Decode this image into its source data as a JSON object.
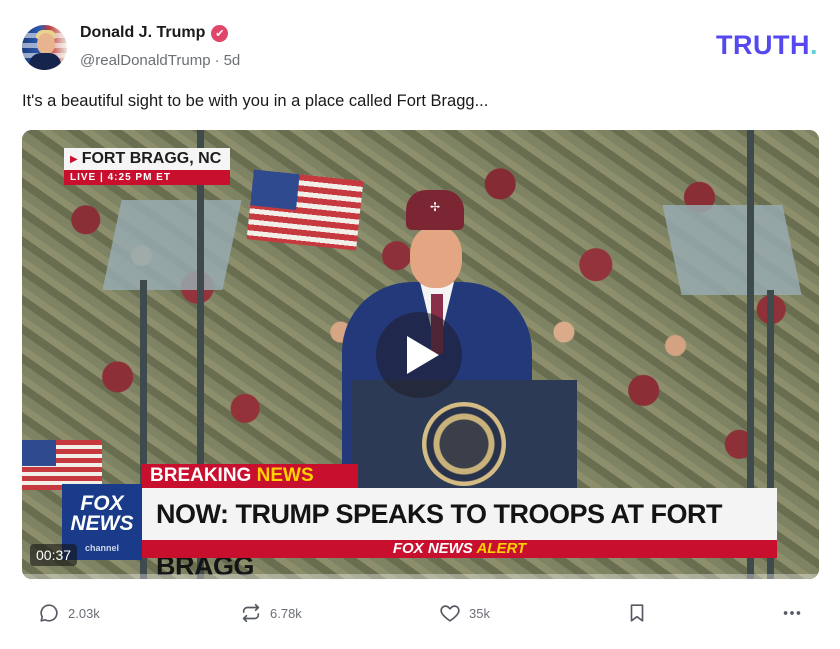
{
  "post": {
    "author_name": "Donald J. Trump",
    "handle": "@realDonaldTrump",
    "separator": "·",
    "age": "5d",
    "text": "It's a beautiful sight to be with you in a place called Fort Bragg...",
    "verified_glyph": "✔"
  },
  "brand": {
    "logo_text": "TRUTH",
    "logo_dot": ".",
    "color": "#5448ee",
    "dot_color": "#5fd1d8"
  },
  "video": {
    "duration": "00:37",
    "progress_fraction": 0.0,
    "overlay": {
      "location": "FORT BRAGG, NC",
      "location_marker": "▶",
      "live": "LIVE",
      "live_sep": "|",
      "time": "4:25 PM ET",
      "breaking_word1": "BREAKING",
      "breaking_word2": "NEWS",
      "network_logo_line1": "FOX",
      "network_logo_line2": "NEWS",
      "network_logo_line3": "channel",
      "headline": "NOW: TRUMP SPEAKS TO TROOPS AT FORT BRAGG",
      "alert_part1": "FOX NEWS",
      "alert_part2": "ALERT",
      "cap_insignia": "✢"
    }
  },
  "actions": {
    "replies": {
      "count": "2.03k",
      "icon": "comment-icon"
    },
    "retruths": {
      "count": "6.78k",
      "icon": "repost-icon"
    },
    "likes": {
      "count": "35k",
      "icon": "heart-icon"
    },
    "bookmark": {
      "icon": "bookmark-icon"
    },
    "more": {
      "icon": "more-icon"
    }
  }
}
